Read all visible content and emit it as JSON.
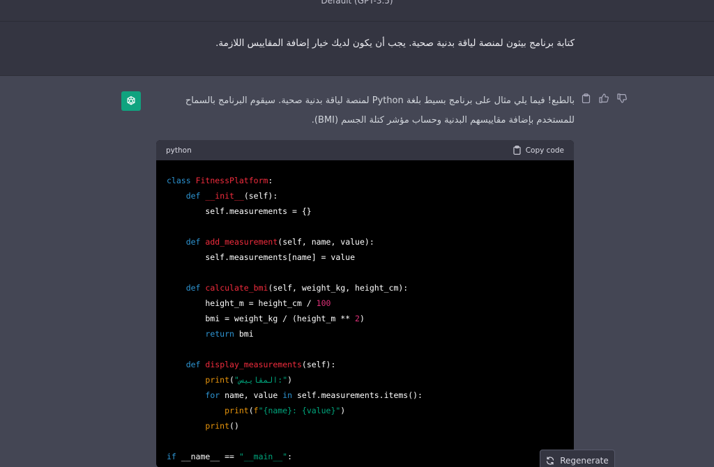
{
  "header": {
    "model_label": "Default (GPT-3.5)"
  },
  "user_message": {
    "text": "كتابة برنامج بيثون لمنصة لياقة بدنية صحية. يجب أن يكون لديك خيار إضافة المقاييس اللازمة."
  },
  "assistant": {
    "text": "بالطبع! فيما يلي مثال على برنامج بسيط بلغة Python لمنصة لياقة بدنية صحية. سيقوم البرنامج بالسماح للمستخدم بإضافة مقاييسهم البدنية وحساب مؤشر كتلة الجسم (BMI).",
    "icons": [
      "clipboard-icon",
      "thumbs-up-icon",
      "thumbs-down-icon"
    ]
  },
  "code_block": {
    "language": "python",
    "copy_label": "Copy code",
    "lines": [
      "class FitnessPlatform:",
      "    def __init__(self):",
      "        self.measurements = {}",
      "",
      "    def add_measurement(self, name, value):",
      "        self.measurements[name] = value",
      "",
      "    def calculate_bmi(self, weight_kg, height_cm):",
      "        height_m = height_cm / 100",
      "        bmi = weight_kg / (height_m ** 2)",
      "        return bmi",
      "",
      "    def display_measurements(self):",
      "        print(\"المقاييس:\")",
      "        for name, value in self.measurements.items():",
      "            print(f\"{name}: {value}\")",
      "        print()",
      "",
      "if __name__ == \"__main__\":"
    ]
  },
  "regenerate": {
    "label": "Regenerate"
  },
  "colors": {
    "assistant_bg": "#444654",
    "user_bg": "#343541",
    "avatar": "#10a37f"
  }
}
